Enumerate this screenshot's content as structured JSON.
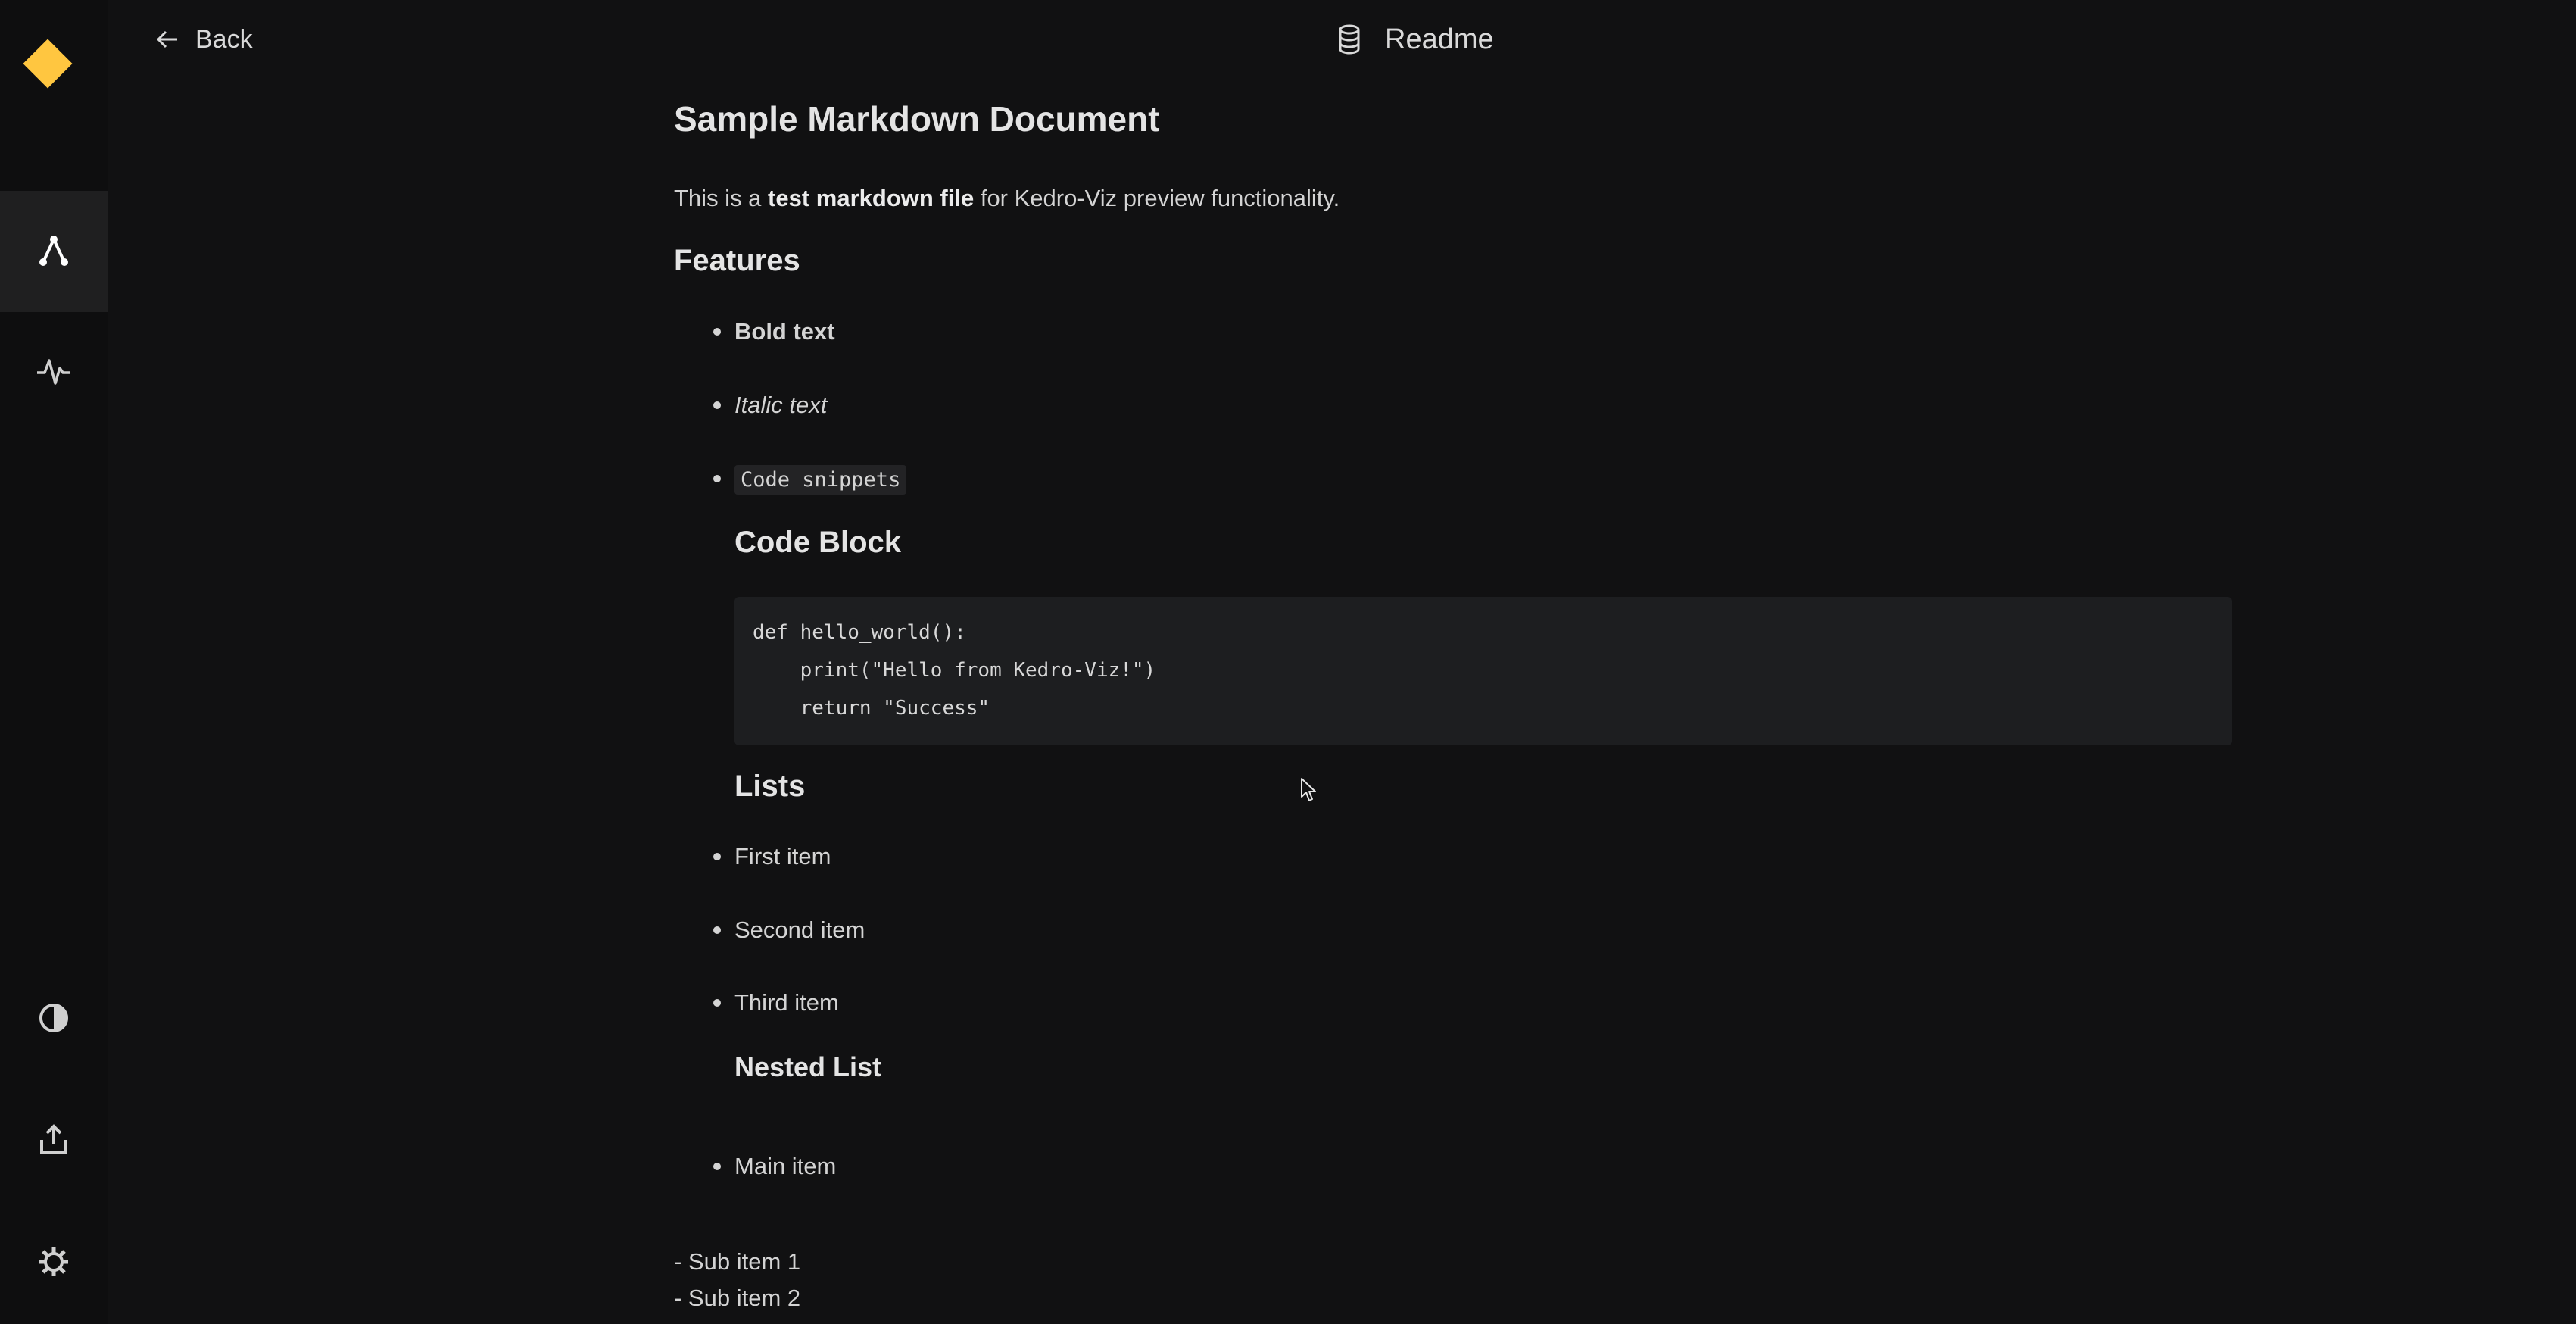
{
  "sidebar": {
    "logo": "kedro-logo-diamond",
    "items": [
      {
        "icon": "flowchart-icon",
        "active": true
      },
      {
        "icon": "experiment-tracking-icon",
        "active": false
      }
    ],
    "bottom_items": [
      {
        "icon": "theme-toggle-icon"
      },
      {
        "icon": "export-icon"
      },
      {
        "icon": "settings-icon"
      }
    ],
    "accent_color": "#ffc640"
  },
  "header": {
    "back_label": "Back",
    "title": "Readme",
    "title_icon": "dataset-icon"
  },
  "doc": {
    "h1": "Sample Markdown Document",
    "intro": {
      "pre": "This is a ",
      "bold": "test markdown file",
      "post": " for Kedro-Viz preview functionality."
    },
    "features_heading": "Features",
    "features": {
      "bold": "Bold text",
      "italic": "Italic text",
      "code": "Code snippets"
    },
    "code_heading": "Code Block",
    "code_block": "def hello_world():\n    print(\"Hello from Kedro-Viz!\")\n    return \"Success\"",
    "lists_heading": "Lists",
    "lists": [
      "First item",
      "Second item",
      "Third item"
    ],
    "nested_heading": "Nested List",
    "nested_main": "Main item",
    "sub_items": [
      "- Sub item 1",
      "- Sub item 2"
    ]
  }
}
